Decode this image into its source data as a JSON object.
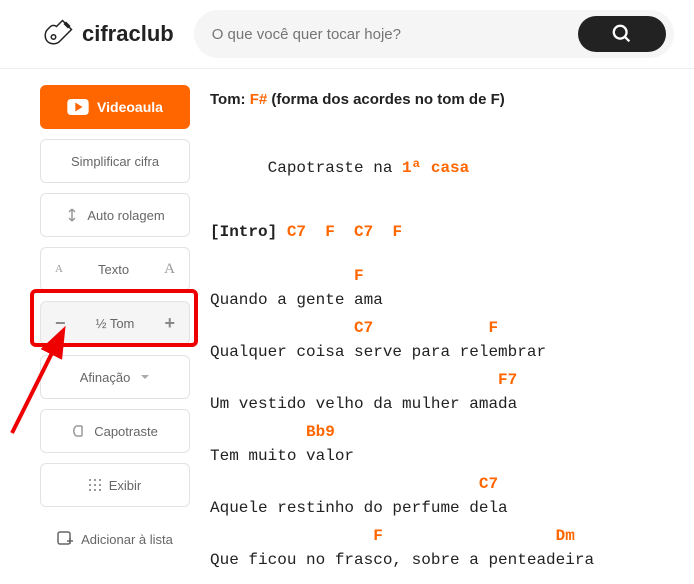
{
  "header": {
    "brand": "cifraclub",
    "search_placeholder": "O que você quer tocar hoje?"
  },
  "sidebar": {
    "videoaula": "Videoaula",
    "simplificar": "Simplificar cifra",
    "autorolagem": "Auto rolagem",
    "texto": "Texto",
    "tom": "½ Tom",
    "afinacao": "Afinação",
    "capotraste": "Capotraste",
    "exibir": "Exibir",
    "adicionar": "Adicionar à lista"
  },
  "content": {
    "tom_label": "Tom: ",
    "tom_key": "F#",
    "tom_note": " (forma dos acordes no tom de F)",
    "capo_label": "Capotraste na ",
    "capo_value": "1ª casa",
    "intro_label": "[Intro]",
    "intro_chords": " C7  F  C7  F",
    "lines": [
      {
        "chords": "               F",
        "lyric": "Quando a gente ama"
      },
      {
        "chords": "               C7            F",
        "lyric": "Qualquer coisa serve para relembrar"
      },
      {
        "chords": "                              F7",
        "lyric": "Um vestido velho da mulher amada"
      },
      {
        "chords": "          Bb9",
        "lyric": "Tem muito valor"
      },
      {
        "chords": "                            C7",
        "lyric": "Aquele restinho do perfume dela"
      },
      {
        "chords": "                 F                  Dm",
        "lyric": "Que ficou no frasco, sobre a penteadeira"
      }
    ]
  }
}
